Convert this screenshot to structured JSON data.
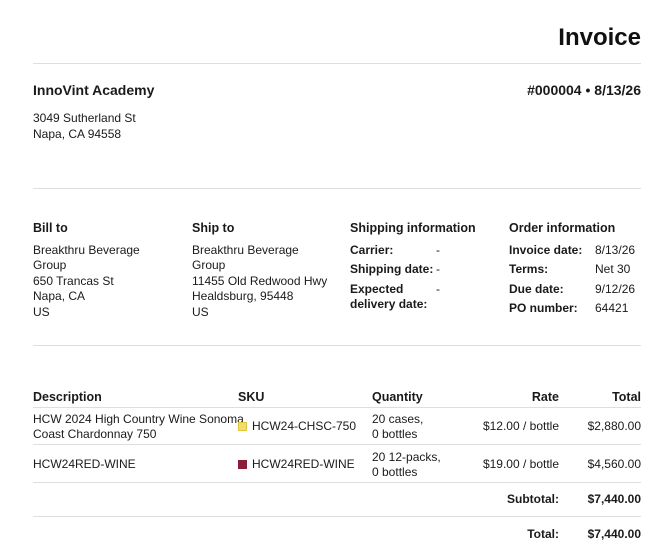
{
  "title": "Invoice",
  "company": {
    "name": "InnoVint Academy",
    "address_line1": "3049 Sutherland St",
    "address_line2": "Napa, CA 94558"
  },
  "invoice_ref": "#000004 • 8/13/26",
  "bill_to": {
    "heading": "Bill to",
    "name_line1": "Breakthru Beverage",
    "name_line2": "Group",
    "street": "650 Trancas St",
    "city": "Napa, CA",
    "country": "US"
  },
  "ship_to": {
    "heading": "Ship to",
    "name_line1": "Breakthru Beverage",
    "name_line2": "Group",
    "street": "11455 Old Redwood Hwy",
    "city": "Healdsburg, 95448",
    "country": "US"
  },
  "shipping": {
    "heading": "Shipping information",
    "carrier_label": "Carrier:",
    "carrier_value": "-",
    "date_label": "Shipping date:",
    "date_value": "-",
    "expected_label_1": "Expected",
    "expected_label_2": "delivery date:",
    "expected_value": "-"
  },
  "order": {
    "heading": "Order information",
    "invoice_date_label": "Invoice date:",
    "invoice_date": "8/13/26",
    "terms_label": "Terms:",
    "terms": "Net 30",
    "due_label": "Due date:",
    "due": "9/12/26",
    "po_label": "PO number:",
    "po": "64421"
  },
  "table": {
    "headers": {
      "description": "Description",
      "sku": "SKU",
      "quantity": "Quantity",
      "rate": "Rate",
      "total": "Total"
    },
    "rows": [
      {
        "desc_line1": "HCW 2024 High Country Wine Sonoma",
        "desc_line2": "Coast Chardonnay 750",
        "sku": "HCW24-CHSC-750",
        "sku_color": "#f2dc6a",
        "qty_line1": "20 cases,",
        "qty_line2": "0 bottles",
        "rate": "$12.00 / bottle",
        "total": "$2,880.00"
      },
      {
        "desc_line1": "HCW24RED-WINE",
        "sku": "HCW24RED-WINE",
        "sku_color": "#8b1f3a",
        "qty_line1": "20 12-packs,",
        "qty_line2": "0 bottles",
        "rate": "$19.00 / bottle",
        "total": "$4,560.00"
      }
    ]
  },
  "subtotal_label": "Subtotal:",
  "subtotal": "$7,440.00",
  "total_label": "Total:",
  "total": "$7,440.00"
}
